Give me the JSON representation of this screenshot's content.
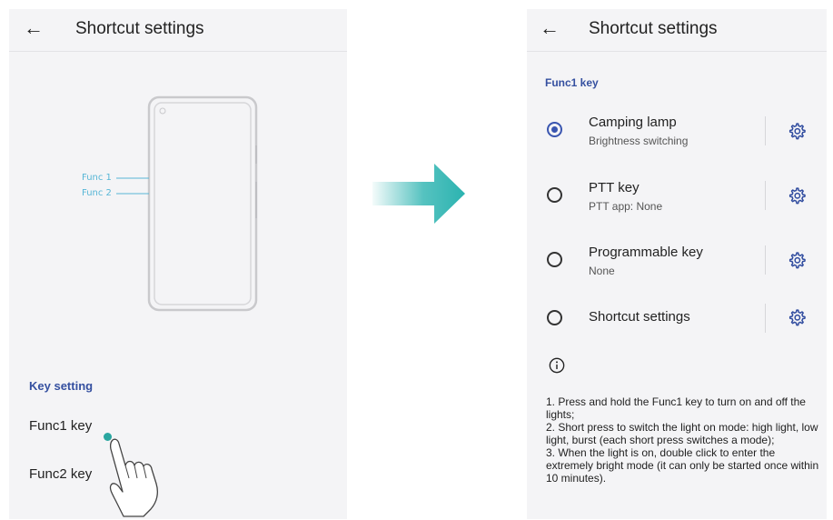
{
  "left_screen": {
    "header": {
      "title": "Shortcut settings",
      "back_icon": "back-arrow-icon"
    },
    "phone_diagram": {
      "func1_label": "Func 1",
      "func2_label": "Func 2"
    },
    "key_setting": {
      "section_label": "Key setting",
      "items": [
        {
          "label": "Func1 key"
        },
        {
          "label": "Func2 key"
        }
      ]
    },
    "tap_hint_icon": "hand-tap-icon"
  },
  "arrow": {
    "icon": "right-arrow-icon",
    "color": "#2bb3b0"
  },
  "right_screen": {
    "header": {
      "title": "Shortcut settings",
      "back_icon": "back-arrow-icon"
    },
    "group_label": "Func1 key",
    "options": [
      {
        "title": "Camping lamp",
        "subtitle": "Brightness switching",
        "selected": true
      },
      {
        "title": "PTT key",
        "subtitle": "PTT app: None",
        "selected": false
      },
      {
        "title": "Programmable key",
        "subtitle": "None",
        "selected": false
      },
      {
        "title": "Shortcut settings",
        "subtitle": "",
        "selected": false
      }
    ],
    "info": {
      "icon": "info-icon",
      "lines": [
        "1. Press and hold the Func1 key to turn on and off the lights;",
        " 2. Short press to switch the light on mode: high light, low light, burst (each short press switches a mode);",
        " 3. When the light is on, double click to enter the extremely bright mode (it can only be started once within 10 minutes)."
      ]
    }
  },
  "colors": {
    "accent": "#3a56b0",
    "section": "#3550a0",
    "func_label": "#57b6d6",
    "background": "#f4f4f6"
  }
}
